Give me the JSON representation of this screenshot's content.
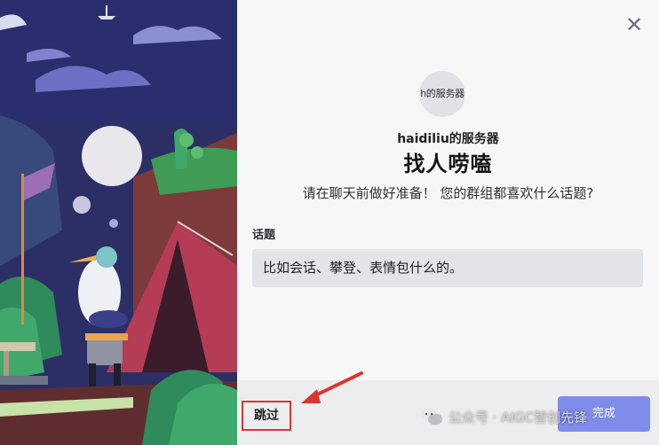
{
  "modal": {
    "avatar_text": "h的服务器",
    "server_name": "haidiliu的服务器",
    "title": "找人唠嗑",
    "subtitle": "请在聊天前做好准备！ 您的群组都喜欢什么话题?",
    "topic_label": "话题",
    "topic_placeholder": "比如会话、攀登、表情包什么的。",
    "close_icon": "close-icon"
  },
  "footer": {
    "skip_label": "跳过",
    "next_label": "完成"
  },
  "watermark": {
    "text": "公众号 · AIGC智创先锋",
    "icon": "wechat-icon"
  },
  "colors": {
    "panel_bg": "#f7f7f7",
    "accent": "#7f8cea",
    "highlight_box": "#d9362f"
  }
}
